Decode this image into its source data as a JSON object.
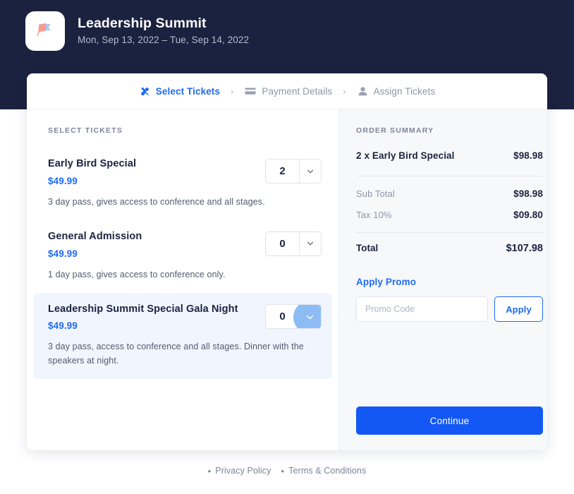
{
  "event": {
    "logo_icon": "flag-icon",
    "name": "Leadership Summit",
    "dates": "Mon, Sep 13, 2022 – Tue, Sep 14, 2022"
  },
  "stepper": {
    "steps": [
      {
        "label": "Select Tickets",
        "icon": "ticket-icon",
        "state": "active"
      },
      {
        "label": "Payment Details",
        "icon": "credit-card-icon",
        "state": "inactive"
      },
      {
        "label": "Assign Tickets",
        "icon": "person-icon",
        "state": "inactive"
      }
    ],
    "separator": "›"
  },
  "tickets": {
    "section_label": "SELECT TICKETS",
    "items": [
      {
        "name": "Early Bird Special",
        "price": "$49.99",
        "description": "3 day pass, gives access to conference and all stages.",
        "quantity": "2",
        "highlighted": false
      },
      {
        "name": "General Admission",
        "price": "$49.99",
        "description": "1 day pass, gives access to conference only.",
        "quantity": "0",
        "highlighted": false
      },
      {
        "name": "Leadership Summit Special Gala Night",
        "price": "$49.99",
        "description": "3 day pass, access to conference and all stages. Dinner with the speakers at night.",
        "quantity": "0",
        "highlighted": true
      }
    ]
  },
  "summary": {
    "section_label": "ORDER SUMMARY",
    "line_item": {
      "label": "2 x Early Bird Special",
      "amount": "$98.98"
    },
    "sub_total": {
      "label": "Sub Total",
      "amount": "$98.98"
    },
    "tax": {
      "label": "Tax 10%",
      "amount": "$09.80"
    },
    "total": {
      "label": "Total",
      "amount": "$107.98"
    },
    "promo_link": "Apply Promo",
    "promo_placeholder": "Promo Code",
    "promo_value": "",
    "apply_label": "Apply",
    "continue_label": "Continue"
  },
  "footer": {
    "bullet": "•",
    "privacy": "Privacy Policy",
    "terms": "Terms & Conditions"
  },
  "colors": {
    "header_bg": "#1b2240",
    "accent_blue": "#1f6bf6",
    "continue_blue": "#1358f5",
    "summary_bg": "#f7f8fa",
    "highlight_bg": "#f1f5fe",
    "hover_bubble": "#8dbcf5"
  }
}
